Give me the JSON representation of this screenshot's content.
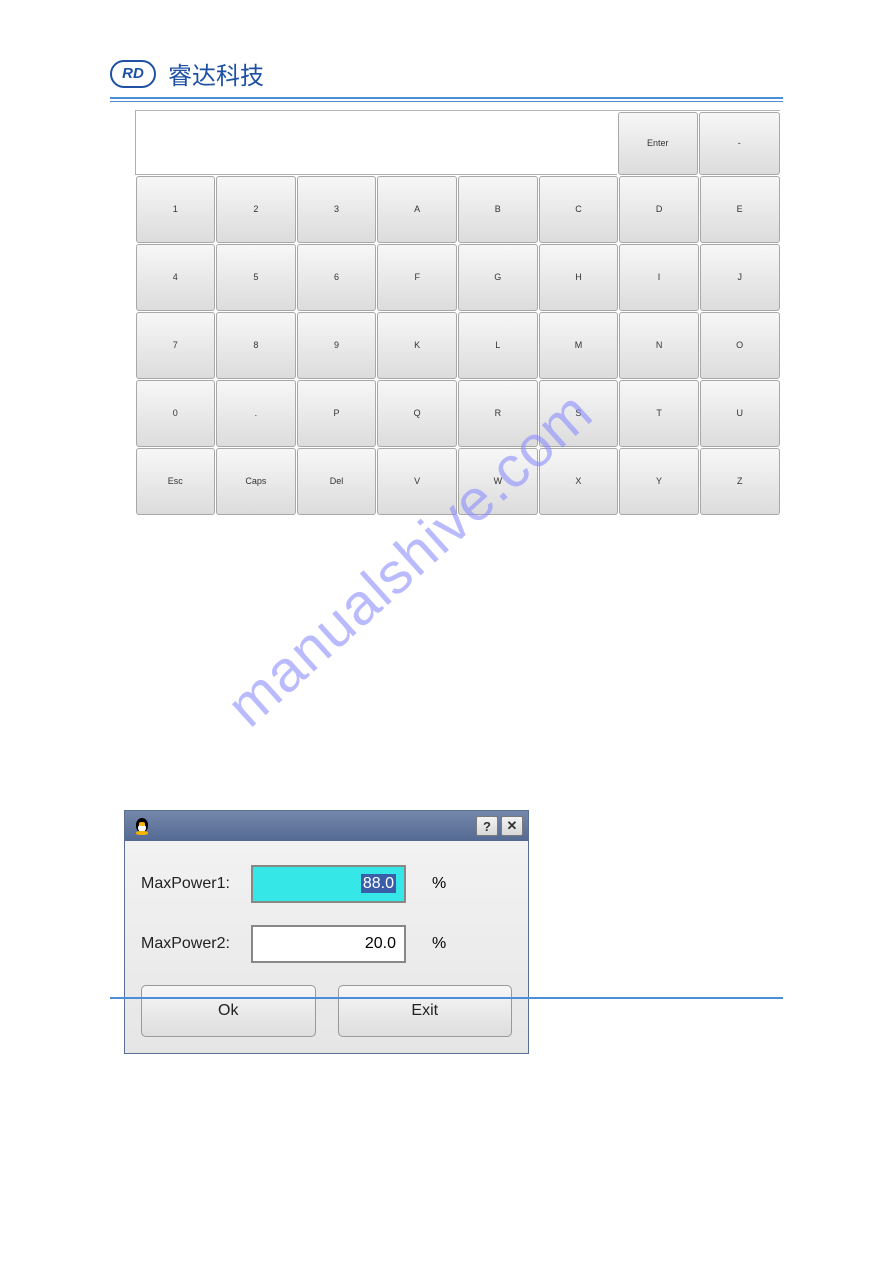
{
  "header": {
    "logo_text": "RD",
    "brand": "睿达科技"
  },
  "keyboard": {
    "top_input": "",
    "top_keys": [
      "Enter",
      "-"
    ],
    "rows": [
      [
        "1",
        "2",
        "3",
        "A",
        "B",
        "C",
        "D",
        "E"
      ],
      [
        "4",
        "5",
        "6",
        "F",
        "G",
        "H",
        "I",
        "J"
      ],
      [
        "7",
        "8",
        "9",
        "K",
        "L",
        "M",
        "N",
        "O"
      ],
      [
        "0",
        ".",
        "P",
        "Q",
        "R",
        "S",
        "T",
        "U"
      ],
      [
        "Esc",
        "Caps",
        "Del",
        "V",
        "W",
        "X",
        "Y",
        "Z"
      ]
    ]
  },
  "watermark": "manualshive.com",
  "dialog": {
    "titlebar": {
      "help_glyph": "?",
      "close_glyph": "✕"
    },
    "rows": [
      {
        "label": "MaxPower1:",
        "value": "88.0",
        "unit": "%",
        "active": true
      },
      {
        "label": "MaxPower2:",
        "value": "20.0",
        "unit": "%",
        "active": false
      }
    ],
    "buttons": {
      "ok": "Ok",
      "exit": "Exit"
    }
  }
}
